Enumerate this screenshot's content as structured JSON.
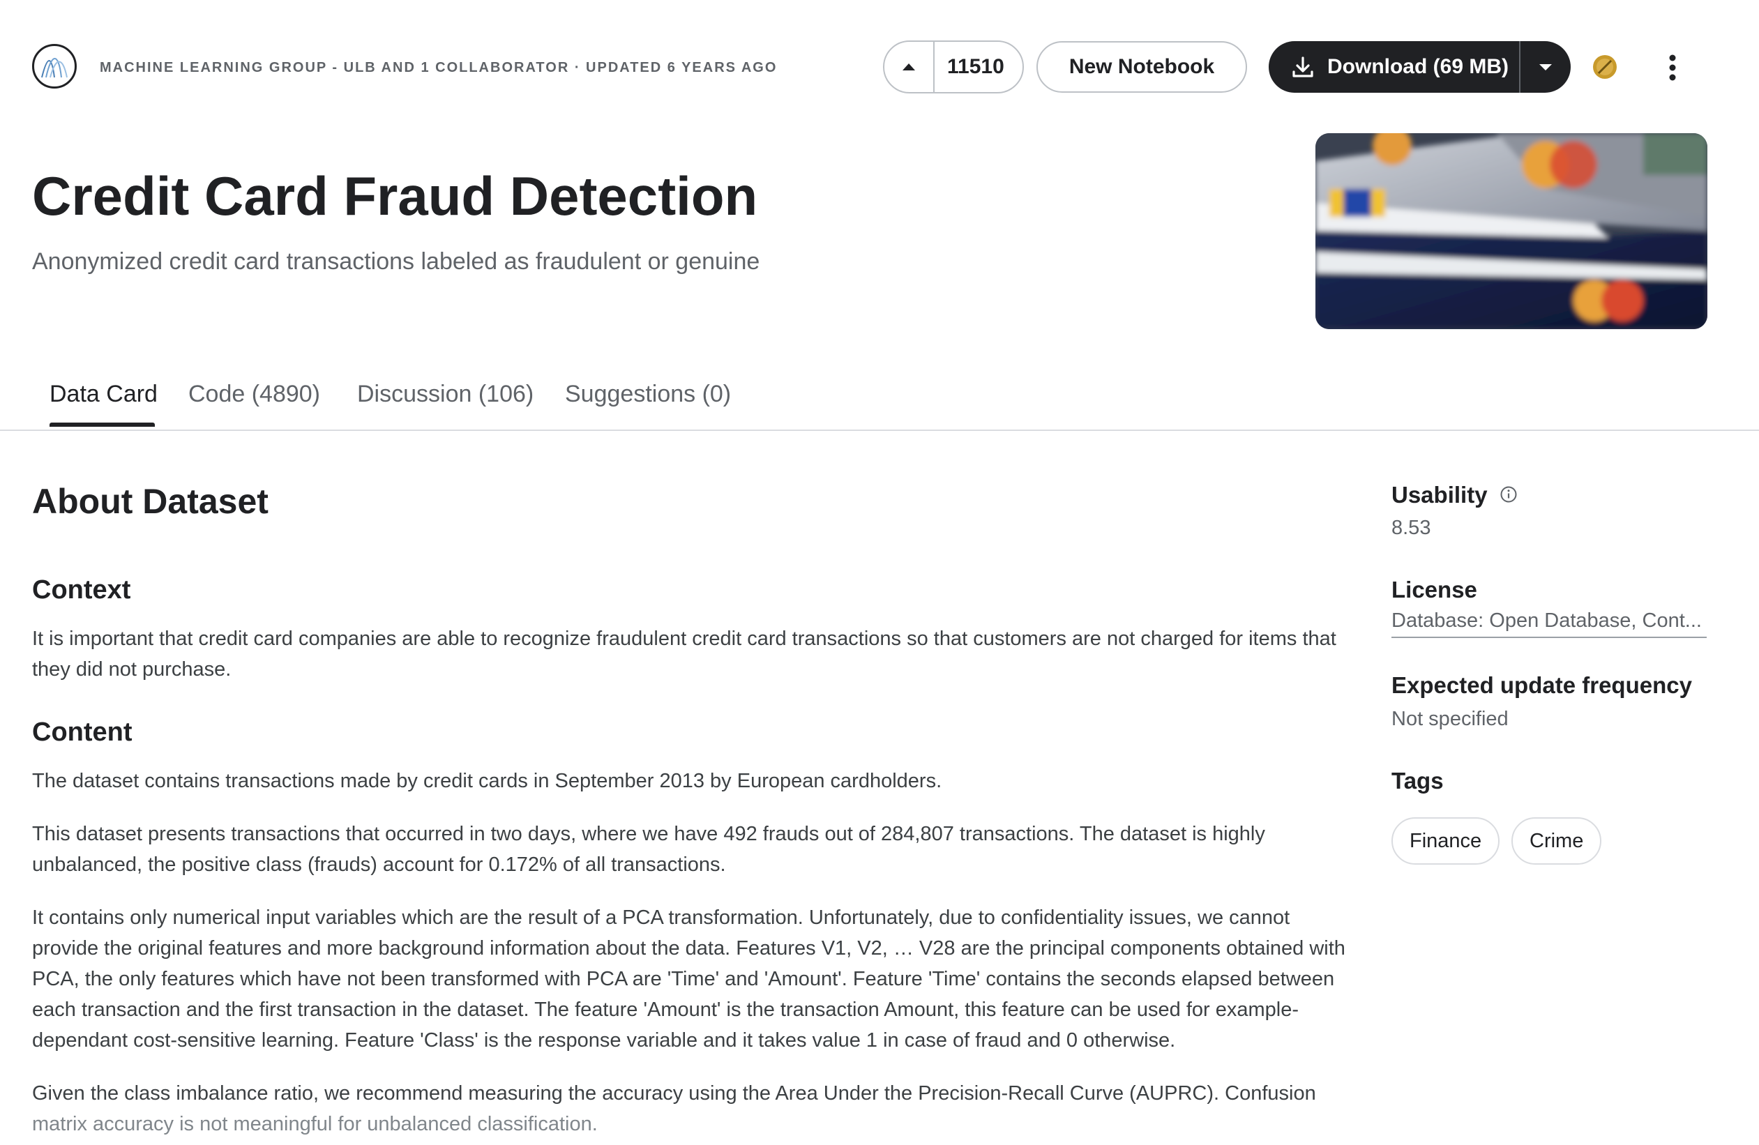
{
  "header": {
    "owner_line": "MACHINE LEARNING GROUP - ULB AND 1 COLLABORATOR · UPDATED 6 YEARS AGO",
    "vote_count": "11510",
    "new_notebook_label": "New Notebook",
    "download_label": "Download (69 MB)"
  },
  "dataset": {
    "title": "Credit Card Fraud Detection",
    "subtitle": "Anonymized credit card transactions labeled as fraudulent or genuine"
  },
  "tabs": [
    {
      "label": "Data Card",
      "active": true
    },
    {
      "label": "Code (4890)",
      "active": false
    },
    {
      "label": "Discussion (106)",
      "active": false
    },
    {
      "label": "Suggestions (0)",
      "active": false
    }
  ],
  "about": {
    "title": "About Dataset",
    "context_heading": "Context",
    "context_text": "It is important that credit card companies are able to recognize fraudulent credit card transactions so that customers are not charged for items that they did not purchase.",
    "content_heading": "Content",
    "content_p1": "The dataset contains transactions made by credit cards in September 2013 by European cardholders.",
    "content_p2": "This dataset presents transactions that occurred in two days, where we have 492 frauds out of 284,807 transactions. The dataset is highly unbalanced, the positive class (frauds) account for 0.172% of all transactions.",
    "content_p3": "It contains only numerical input variables which are the result of a PCA transformation. Unfortunately, due to confidentiality issues, we cannot provide the original features and more background information about the data. Features V1, V2, … V28 are the principal components obtained with PCA, the only features which have not been transformed with PCA are 'Time' and 'Amount'. Feature 'Time' contains the seconds elapsed between each transaction and the first transaction in the dataset. The feature 'Amount' is the transaction Amount, this feature can be used for example-dependant cost-sensitive learning. Feature 'Class' is the response variable and it takes value 1 in case of fraud and 0 otherwise.",
    "content_p4_line1": "Given the class imbalance ratio, we recommend measuring the accuracy using the Area Under the Precision-Recall Curve (AUPRC). Confusion",
    "content_p4_line2": "matrix accuracy is not meaningful for unbalanced classification."
  },
  "sidebar": {
    "usability_label": "Usability",
    "usability_value": "8.53",
    "license_label": "License",
    "license_value": "Database: Open Database, Cont...",
    "update_label": "Expected update frequency",
    "update_value": "Not specified",
    "tags_label": "Tags",
    "tags": [
      "Finance",
      "Crime"
    ]
  },
  "icons": {
    "owner_avatar": "ulb-logo-icon",
    "upvote": "upvote-arrow-icon",
    "download": "download-icon",
    "dropdown": "chevron-down-icon",
    "medal": "medal-icon",
    "more": "more-vertical-icon",
    "info": "info-icon"
  },
  "colors": {
    "primary_dark": "#202124",
    "muted_text": "#5f6368",
    "border": "#dadce0",
    "medal": "#c89a2b"
  }
}
